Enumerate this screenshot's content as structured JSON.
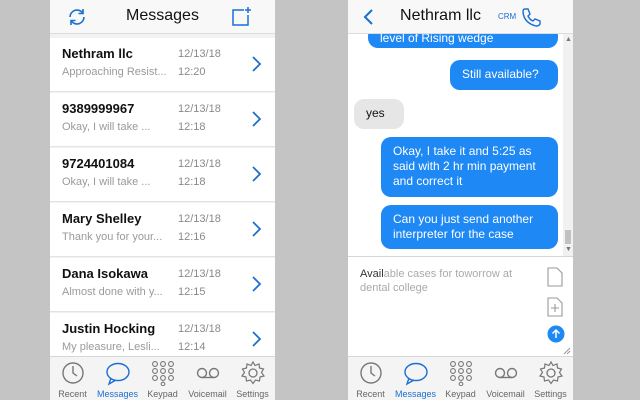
{
  "left": {
    "header": {
      "title": "Messages",
      "refresh_icon": "refresh-icon",
      "compose_icon": "compose-icon"
    },
    "conversations": [
      {
        "name": "Nethram llc",
        "preview": "Approaching Resist...",
        "date": "12/13/18",
        "time": "12:20"
      },
      {
        "name": "9389999967",
        "preview": "Okay, I will take ...",
        "date": "12/13/18",
        "time": "12:18"
      },
      {
        "name": "9724401084",
        "preview": "Okay, I will take ...",
        "date": "12/13/18",
        "time": "12:18"
      },
      {
        "name": "Mary Shelley",
        "preview": "Thank you for your...",
        "date": "12/13/18",
        "time": "12:16"
      },
      {
        "name": "Dana Isokawa",
        "preview": "Almost done with y...",
        "date": "12/13/18",
        "time": "12:15"
      },
      {
        "name": "Justin Hocking",
        "preview": "My pleasure, Lesli...",
        "date": "12/13/18",
        "time": "12:14"
      }
    ]
  },
  "right": {
    "header": {
      "title": "Nethram llc",
      "crm": "CRM"
    },
    "messages": [
      {
        "direction": "out",
        "text": "level of Rising wedge"
      },
      {
        "direction": "out",
        "text": "Still available?"
      },
      {
        "direction": "in",
        "text": "yes"
      },
      {
        "direction": "out",
        "text": "Okay, I take it and 5:25 as said with 2 hr min payment and correct it"
      },
      {
        "direction": "out",
        "text": "Can you just send another interpreter for the case"
      }
    ],
    "composer": {
      "typed": "Avail",
      "suggestion": "able cases for toworrow at dental college"
    }
  },
  "tabs": [
    {
      "label": "Recent",
      "icon": "clock-icon"
    },
    {
      "label": "Messages",
      "icon": "chat-bubble-icon",
      "active": true
    },
    {
      "label": "Keypad",
      "icon": "keypad-icon"
    },
    {
      "label": "Voicemail",
      "icon": "voicemail-icon"
    },
    {
      "label": "Settings",
      "icon": "gear-icon"
    }
  ],
  "colors": {
    "accent": "#1e88f5",
    "incoming_bubble": "#e6e6e6",
    "background": "#c4c4c4"
  }
}
